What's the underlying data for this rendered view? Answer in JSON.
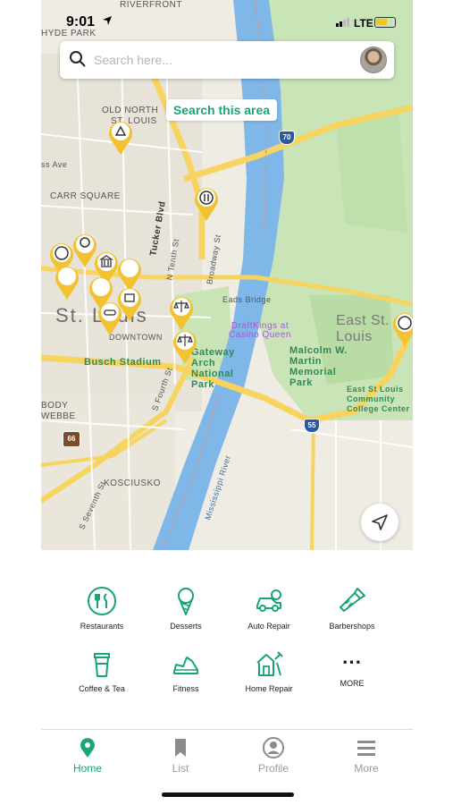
{
  "status_bar": {
    "time": "9:01",
    "network": "LTE"
  },
  "search": {
    "placeholder": "Search here..."
  },
  "search_area_button": "Search this area",
  "map_labels": {
    "riverfront": "RIVERFRONT",
    "hyde_park": "HYDE PARK",
    "old_north": "OLD NORTH",
    "st_louis_small": "ST. LOUIS",
    "carr_square": "CARR SQUARE",
    "tucker": "Tucker Blvd",
    "n_tenth": "N Tenth St",
    "broadway": "Broadway St",
    "eads_bridge": "Eads Bridge",
    "st_louis_big": "St. Louis",
    "downtown": "DOWNTOWN",
    "draftkings": "DraftKings at Casino Queen",
    "east_st_louis": "East St. Louis",
    "busch": "Busch Stadium",
    "gateway": "Gateway Arch National Park",
    "malcolm": "Malcolm W. Martin Memorial Park",
    "college": "East St Louis Community College Center",
    "mississippi": "Mississippi River",
    "kosciusko": "KOSCIUSKO",
    "seventh": "S Seventh St",
    "fourth": "S Fourth St",
    "body": "BODY",
    "webbe": "WEBBE",
    "ss_ave": "ss Ave",
    "i70": "70",
    "i55": "55",
    "us66": "66"
  },
  "categories": [
    {
      "label": "Restaurants",
      "icon": "restaurant-icon"
    },
    {
      "label": "Desserts",
      "icon": "ice-cream-icon"
    },
    {
      "label": "Auto Repair",
      "icon": "car-repair-icon"
    },
    {
      "label": "Barbershops",
      "icon": "clippers-icon"
    },
    {
      "label": "Coffee & Tea",
      "icon": "coffee-cup-icon"
    },
    {
      "label": "Fitness",
      "icon": "shoe-icon"
    },
    {
      "label": "Home Repair",
      "icon": "house-tools-icon"
    },
    {
      "label": "MORE",
      "icon": "more-dots-icon"
    }
  ],
  "tabs": [
    {
      "label": "Home",
      "icon": "map-pin-icon",
      "active": true
    },
    {
      "label": "List",
      "icon": "bookmark-icon",
      "active": false
    },
    {
      "label": "Profile",
      "icon": "person-icon",
      "active": false
    },
    {
      "label": "More",
      "icon": "menu-icon",
      "active": false
    }
  ],
  "colors": {
    "accent": "#1ba37a",
    "pin": "#f2c230",
    "river": "#7fb7e8",
    "park": "#c9e4b7",
    "highway": "#f7d460"
  }
}
